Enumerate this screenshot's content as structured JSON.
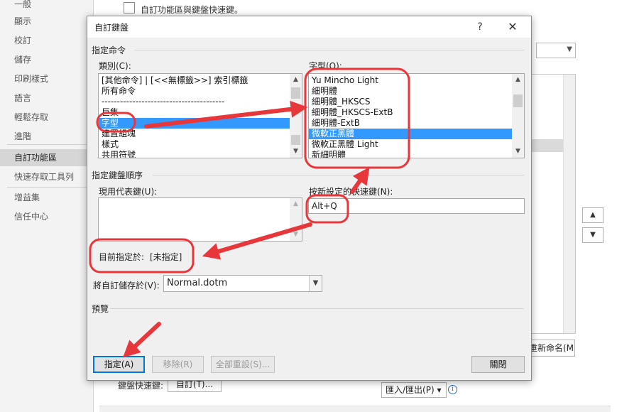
{
  "options_window": {
    "nav": [
      {
        "label": "一般",
        "active": false
      },
      {
        "label": "顯示",
        "active": false
      },
      {
        "label": "校訂",
        "active": false
      },
      {
        "label": "儲存",
        "active": false
      },
      {
        "label": "印刷樣式",
        "active": false
      },
      {
        "label": "語言",
        "active": false
      },
      {
        "label": "輕鬆存取",
        "active": false
      },
      {
        "label": "進階",
        "active": false
      },
      {
        "label": "自訂功能區",
        "active": true
      },
      {
        "label": "快速存取工具列",
        "active": false
      },
      {
        "label": "增益集",
        "active": false
      },
      {
        "label": "信任中心",
        "active": false
      }
    ],
    "header_text": "自訂功能區與鍵盤快速鍵。",
    "rename_button": "重新命名(M)...",
    "shortcuts_label": "鍵盤快速鍵:",
    "customize_button": "自訂(T)...",
    "import_export_button": "匯入/匯出(P) ▾",
    "up_arrow": "▲",
    "down_arrow": "▼"
  },
  "dialog": {
    "title": "自訂鍵盤",
    "help": "?",
    "close": "✕",
    "specify_command_group": "指定命令",
    "categories_label": "類別(C):",
    "categories": [
      "[其他命令] | [<<無標籤>>] 索引標籤",
      "所有命令",
      "----------------------------------------",
      "巨集",
      "字型",
      "建置組塊",
      "樣式",
      "共用符號"
    ],
    "categories_selected": 4,
    "fonts_label": "字型(O):",
    "fonts": [
      "Yu Mincho Light",
      "細明體",
      "細明體_HKSCS",
      "細明體_HKSCS-ExtB",
      "細明體-ExtB",
      "微軟正黑體",
      "微軟正黑體 Light",
      "新細明體"
    ],
    "fonts_selected": 5,
    "key_order_group": "指定鍵盤順序",
    "current_keys_label": "現用代表鍵(U):",
    "new_shortcut_label": "按新設定的快速鍵(N):",
    "new_shortcut_value": "Alt+Q",
    "currently_assigned_label": "目前指定於:",
    "currently_assigned_value": "[未指定]",
    "save_in_label": "將自訂儲存於(V):",
    "save_in_value": "Normal.dotm",
    "preview_group": "預覽",
    "assign_button": "指定(A)",
    "remove_button": "移除(R)",
    "reset_all_button": "全部重設(S)...",
    "close_button": "關閉"
  },
  "colors": {
    "selection": "#3399ff",
    "annotation_red": "#e8373b",
    "focus_blue": "#0078d7"
  }
}
